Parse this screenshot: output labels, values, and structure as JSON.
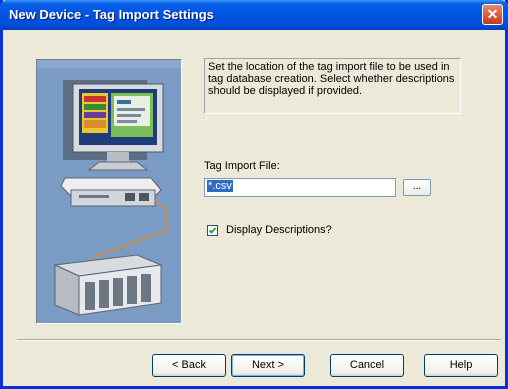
{
  "window": {
    "title": "New Device - Tag Import Settings",
    "close_symbol": "✕"
  },
  "instructions": "Set the location of the tag import file to be used in tag database creation.  Select whether descriptions should be displayed if provided.",
  "tag_import": {
    "label": "Tag Import File:",
    "value": "*.csv",
    "browse_label": "..."
  },
  "descriptions": {
    "label": "Display Descriptions?",
    "checked": true
  },
  "buttons": {
    "back": "< Back",
    "next": "Next >",
    "cancel": "Cancel",
    "help": "Help"
  },
  "icons": [
    "close-icon",
    "checkmark-icon",
    "wizard-computer-network-illustration"
  ],
  "colors": {
    "title_bar": "#0054e3",
    "dialog_bg": "#ece9d8",
    "illustration_bg": "#7a9bc3",
    "selection": "#316ac5"
  }
}
